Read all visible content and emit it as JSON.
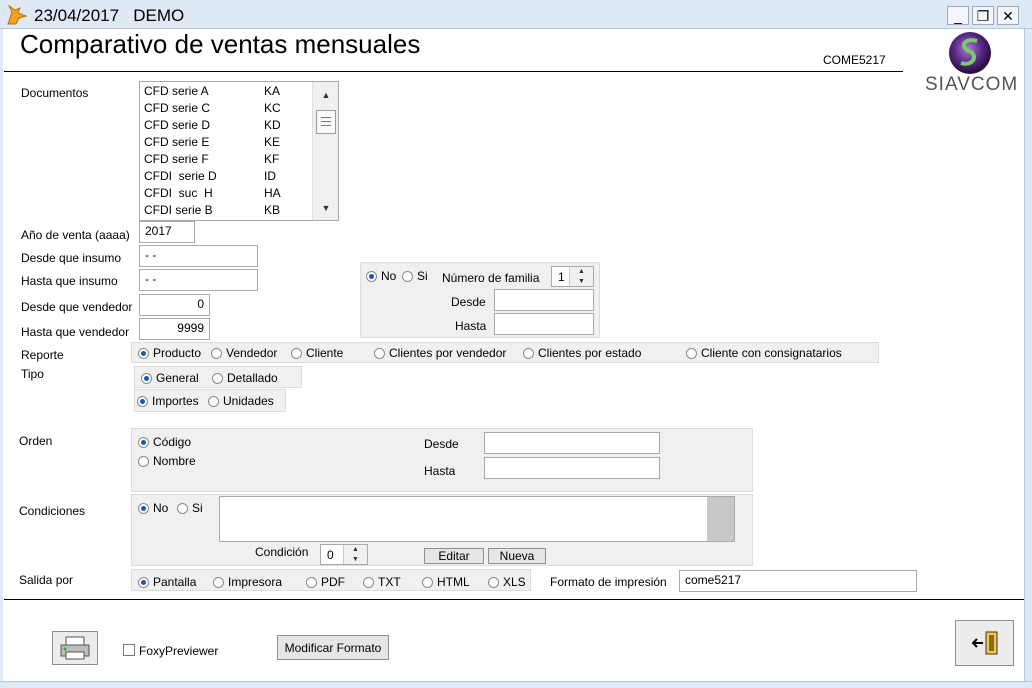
{
  "window": {
    "title": "23/04/2017   DEMO",
    "minimize": "_",
    "restore": "❐",
    "close": "✕"
  },
  "header": {
    "title": "Comparativo de ventas mensuales",
    "code": "COME5217",
    "logo_text": "SIAVCOM"
  },
  "documentos": {
    "label": "Documentos",
    "items": [
      {
        "name": "CFD serie A",
        "code": "KA"
      },
      {
        "name": "CFD serie C",
        "code": "KC"
      },
      {
        "name": "CFD serie D",
        "code": "KD"
      },
      {
        "name": "CFD serie E",
        "code": "KE"
      },
      {
        "name": "CFD serie F",
        "code": "KF"
      },
      {
        "name": "CFDI  serie D",
        "code": "ID"
      },
      {
        "name": "CFDI  suc  H",
        "code": "HA"
      },
      {
        "name": "CFDI serie B",
        "code": "KB"
      }
    ]
  },
  "anio": {
    "label": "Año de venta (aaaa)",
    "value": "2017"
  },
  "insumo": {
    "desde_label": "Desde que insumo",
    "desde_value": " - -",
    "hasta_label": "Hasta que insumo",
    "hasta_value": " - -"
  },
  "vendedor": {
    "desde_label": "Desde que vendedor",
    "desde_value": "0",
    "hasta_label": "Hasta que vendedor",
    "hasta_value": "9999"
  },
  "familia": {
    "no_label": "No",
    "si_label": "Si",
    "numero_label": "Número de familia",
    "numero_value": "1",
    "desde_label": "Desde",
    "hasta_label": "Hasta"
  },
  "reporte": {
    "label": "Reporte",
    "options": [
      "Producto",
      "Vendedor",
      "Cliente",
      "Clientes por vendedor",
      "Clientes por estado",
      "Cliente con consignatarios"
    ]
  },
  "tipo": {
    "label": "Tipo",
    "opt1": [
      "General",
      "Detallado"
    ],
    "opt2": [
      "Importes",
      "Unidades"
    ]
  },
  "orden": {
    "label": "Orden",
    "options": [
      "Código",
      "Nombre"
    ],
    "desde_label": "Desde",
    "hasta_label": "Hasta"
  },
  "condiciones": {
    "label": "Condiciones",
    "no_label": "No",
    "si_label": "Si",
    "condicion_label": "Condición",
    "condicion_value": "0",
    "editar": "Editar",
    "nueva": "Nueva"
  },
  "salida": {
    "label": "Salida por",
    "options": [
      "Pantalla",
      "Impresora",
      "PDF",
      "TXT",
      "HTML",
      "XLS"
    ],
    "formato_label": "Formato de impresión",
    "formato_value": "come5217"
  },
  "footer": {
    "foxy_label": "FoxyPreviewer",
    "modificar": "Modificar Formato"
  },
  "colors": {
    "titlebar": "#dfe8f5",
    "radio_selected": "#1a55b5",
    "panel": "#f0f0f0"
  }
}
